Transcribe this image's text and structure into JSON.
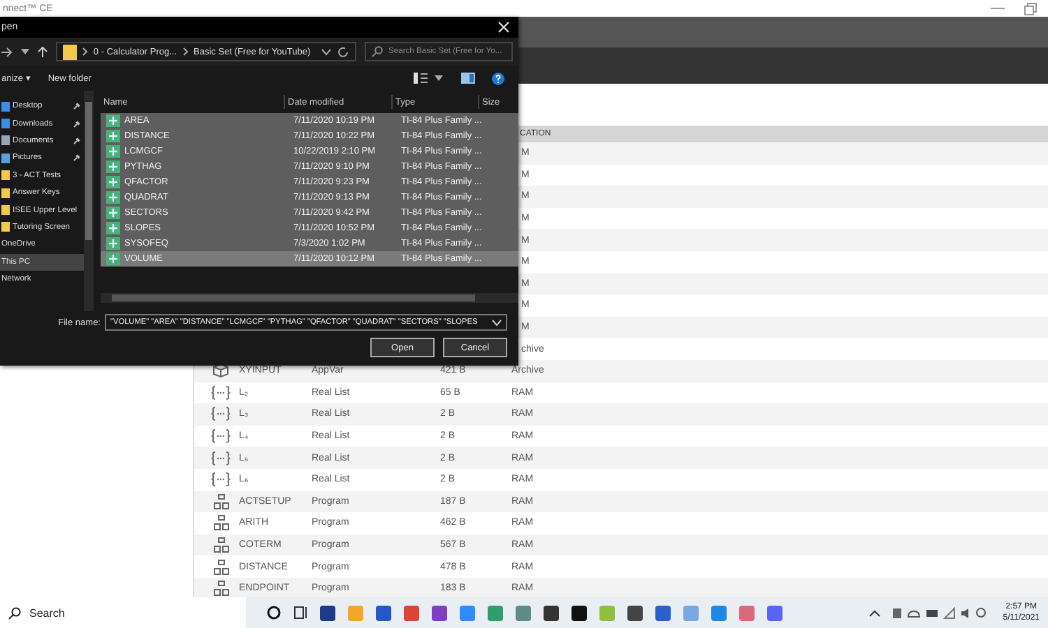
{
  "app": {
    "title": "nnect™ CE"
  },
  "table": {
    "columns": [
      {
        "label": "CATION"
      }
    ],
    "rows": [
      {
        "location": "M"
      },
      {
        "location": "M"
      },
      {
        "location": "M"
      },
      {
        "location": "M"
      },
      {
        "location": "M"
      },
      {
        "location": "M"
      },
      {
        "location": "M"
      },
      {
        "location": "M"
      },
      {
        "location": "M"
      },
      {
        "location": "chive"
      },
      {
        "kind": "appvar",
        "name": "XYINPUT",
        "type": "AppVar",
        "size": "421 B",
        "location": "Archive"
      },
      {
        "kind": "list",
        "name": "L₂",
        "type": "Real List",
        "size": "65 B",
        "location": "RAM"
      },
      {
        "kind": "list",
        "name": "L₃",
        "type": "Real List",
        "size": "2 B",
        "location": "RAM"
      },
      {
        "kind": "list",
        "name": "L₄",
        "type": "Real List",
        "size": "2 B",
        "location": "RAM"
      },
      {
        "kind": "list",
        "name": "L₅",
        "type": "Real List",
        "size": "2 B",
        "location": "RAM"
      },
      {
        "kind": "list",
        "name": "L₆",
        "type": "Real List",
        "size": "2 B",
        "location": "RAM"
      },
      {
        "kind": "program",
        "name": "ACTSETUP",
        "type": "Program",
        "size": "187 B",
        "location": "RAM"
      },
      {
        "kind": "program",
        "name": "ARITH",
        "type": "Program",
        "size": "462 B",
        "location": "RAM"
      },
      {
        "kind": "program",
        "name": "COTERM",
        "type": "Program",
        "size": "567 B",
        "location": "RAM"
      },
      {
        "kind": "program",
        "name": "DISTANCE",
        "type": "Program",
        "size": "478 B",
        "location": "RAM"
      },
      {
        "kind": "program",
        "name": "ENDPOINT",
        "type": "Program",
        "size": "183 B",
        "location": "RAM"
      }
    ]
  },
  "dialog": {
    "title": "pen",
    "breadcrumb": [
      "0 - Calculator Prog...",
      "Basic Set (Free for YouTube)"
    ],
    "search": {
      "placeholder": "Search Basic Set (Free for Yo..."
    },
    "organize": "anize ▾",
    "new_folder": "New folder",
    "nav": [
      {
        "label": "Desktop",
        "pinned": true,
        "selected": false,
        "color": "#3a8ee6"
      },
      {
        "label": "Downloads",
        "pinned": true,
        "selected": false,
        "color": "#3a8ee6"
      },
      {
        "label": "Documents",
        "pinned": true,
        "selected": false,
        "color": "#9aa6b8"
      },
      {
        "label": "Pictures",
        "pinned": true,
        "selected": false,
        "color": "#5aa0e0"
      },
      {
        "label": "3 - ACT Tests",
        "pinned": false,
        "selected": false,
        "color": "#f2c94c"
      },
      {
        "label": "Answer Keys",
        "pinned": false,
        "selected": false,
        "color": "#f2c94c"
      },
      {
        "label": "ISEE Upper Level",
        "pinned": false,
        "selected": false,
        "color": "#f2c94c"
      },
      {
        "label": "Tutoring Screen",
        "pinned": false,
        "selected": false,
        "color": "#f2c94c"
      },
      {
        "label": "OneDrive",
        "pinned": false,
        "selected": false
      },
      {
        "label": "This PC",
        "pinned": false,
        "selected": true
      },
      {
        "label": "Network",
        "pinned": false,
        "selected": false
      }
    ],
    "columns": [
      "Name",
      "Date modified",
      "Type",
      "Size"
    ],
    "files": [
      {
        "name": "AREA",
        "date": "7/11/2020 10:19 PM",
        "type": "TI-84 Plus Family ...",
        "selected": true,
        "focused": false
      },
      {
        "name": "DISTANCE",
        "date": "7/11/2020 10:22 PM",
        "type": "TI-84 Plus Family ...",
        "selected": true,
        "focused": false
      },
      {
        "name": "LCMGCF",
        "date": "10/22/2019 2:10 PM",
        "type": "TI-84 Plus Family ...",
        "selected": true,
        "focused": false
      },
      {
        "name": "PYTHAG",
        "date": "7/11/2020 9:10 PM",
        "type": "TI-84 Plus Family ...",
        "selected": true,
        "focused": false
      },
      {
        "name": "QFACTOR",
        "date": "7/11/2020 9:23 PM",
        "type": "TI-84 Plus Family ...",
        "selected": true,
        "focused": false
      },
      {
        "name": "QUADRAT",
        "date": "7/11/2020 9:13 PM",
        "type": "TI-84 Plus Family ...",
        "selected": true,
        "focused": false
      },
      {
        "name": "SECTORS",
        "date": "7/11/2020 9:42 PM",
        "type": "TI-84 Plus Family ...",
        "selected": true,
        "focused": false
      },
      {
        "name": "SLOPES",
        "date": "7/11/2020 10:52 PM",
        "type": "TI-84 Plus Family ...",
        "selected": true,
        "focused": false
      },
      {
        "name": "SYSOFEQ",
        "date": "7/3/2020 1:02 PM",
        "type": "TI-84 Plus Family ...",
        "selected": true,
        "focused": false
      },
      {
        "name": "VOLUME",
        "date": "7/11/2020 10:12 PM",
        "type": "TI-84 Plus Family ...",
        "selected": true,
        "focused": true
      }
    ],
    "filename_label": "File name:",
    "filename": "\"VOLUME\" \"AREA\" \"DISTANCE\" \"LCMGCF\" \"PYTHAG\" \"QFACTOR\" \"QUADRAT\" \"SECTORS\" \"SLOPES",
    "buttons": [
      "Open",
      "Cancel"
    ]
  },
  "taskbar": {
    "search": "Search",
    "apps": [
      {
        "color": "#1e3a8a"
      },
      {
        "color": "#f4a52b"
      },
      {
        "color": "#2458c9"
      },
      {
        "color": "#db4437"
      },
      {
        "color": "#7b3fbf"
      },
      {
        "color": "#2d8cff"
      },
      {
        "color": "#2e9e6a"
      },
      {
        "color": "#5f8a86"
      },
      {
        "color": "#333333"
      },
      {
        "color": "#111111"
      },
      {
        "color": "#8fbf3f"
      },
      {
        "color": "#444444"
      },
      {
        "color": "#2a62c9"
      },
      {
        "color": "#7aa7e0"
      },
      {
        "color": "#1e88e5"
      },
      {
        "color": "#d96a7a"
      },
      {
        "color": "#5865f2"
      }
    ],
    "time": "2:57 PM",
    "date": "5/11/2021"
  }
}
